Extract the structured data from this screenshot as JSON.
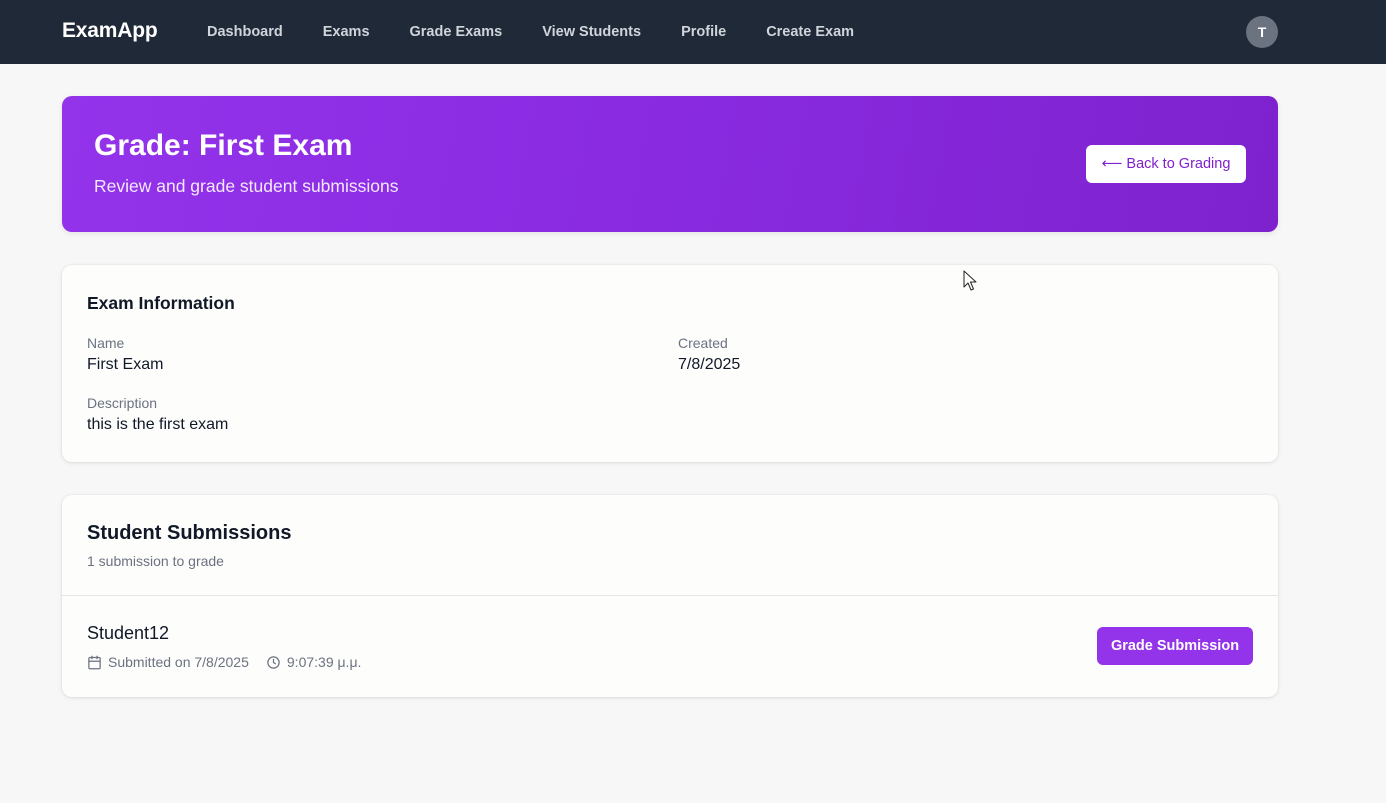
{
  "nav": {
    "brand": "ExamApp",
    "links": [
      "Dashboard",
      "Exams",
      "Grade Exams",
      "View Students",
      "Profile",
      "Create Exam"
    ],
    "avatar_initial": "T"
  },
  "hero": {
    "title": "Grade: First Exam",
    "subtitle": "Review and grade student submissions",
    "back_button": "⟵ Back to Grading"
  },
  "exam_info": {
    "heading": "Exam Information",
    "name_label": "Name",
    "name_value": "First Exam",
    "created_label": "Created",
    "created_value": "7/8/2025",
    "description_label": "Description",
    "description_value": "this is the first exam"
  },
  "submissions": {
    "heading": "Student Submissions",
    "count_text": "1 submission to grade",
    "items": [
      {
        "student": "Student12",
        "submitted_text": "Submitted on 7/8/2025",
        "time_text": "9:07:39 μ.μ.",
        "action": "Grade Submission"
      }
    ]
  },
  "colors": {
    "nav_bg": "#1f2937",
    "accent": "#9333ea",
    "page_bg": "#f7f7f8"
  }
}
